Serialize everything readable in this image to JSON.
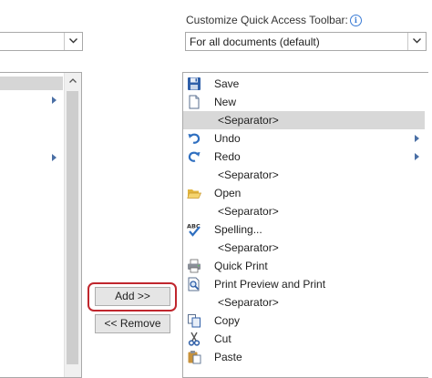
{
  "left_panel": {
    "combo_value": "",
    "has_submenus": [
      true,
      true
    ]
  },
  "right_panel": {
    "label": "Customize Quick Access Toolbar:",
    "combo_value": "For all documents (default)",
    "items": [
      {
        "label": "Save",
        "icon": "save-icon"
      },
      {
        "label": "New",
        "icon": "new-document-icon"
      },
      {
        "label": "<Separator>",
        "icon": "",
        "selected": true
      },
      {
        "label": "Undo",
        "icon": "undo-icon",
        "submenu": true
      },
      {
        "label": "Redo",
        "icon": "redo-icon",
        "submenu": true
      },
      {
        "label": "<Separator>",
        "icon": ""
      },
      {
        "label": "Open",
        "icon": "open-folder-icon"
      },
      {
        "label": "<Separator>",
        "icon": ""
      },
      {
        "label": "Spelling...",
        "icon": "spelling-icon"
      },
      {
        "label": "<Separator>",
        "icon": ""
      },
      {
        "label": "Quick Print",
        "icon": "quick-print-icon"
      },
      {
        "label": "Print Preview and Print",
        "icon": "print-preview-icon"
      },
      {
        "label": "<Separator>",
        "icon": ""
      },
      {
        "label": "Copy",
        "icon": "copy-icon"
      },
      {
        "label": "Cut",
        "icon": "cut-icon"
      },
      {
        "label": "Paste",
        "icon": "paste-icon"
      }
    ]
  },
  "buttons": {
    "add_label": "Add >>",
    "remove_label": "<< Remove"
  },
  "colors": {
    "highlight_ring": "#c0262d",
    "selection": "#d8d8d8",
    "info_icon": "#3a7bd5"
  }
}
